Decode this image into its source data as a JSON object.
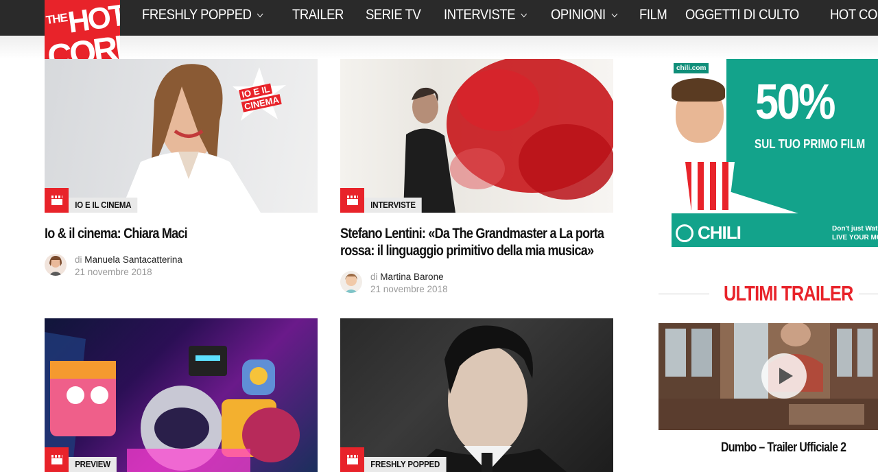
{
  "logo": {
    "line1": "THE",
    "line2": "HOT",
    "line3": "CORN"
  },
  "nav": {
    "items": [
      {
        "label": "FRESHLY POPPED",
        "dropdown": true
      },
      {
        "label": "TRAILER",
        "dropdown": false
      },
      {
        "label": "SERIE TV",
        "dropdown": false
      },
      {
        "label": "INTERVISTE",
        "dropdown": true
      },
      {
        "label": "OPINIONI",
        "dropdown": true
      },
      {
        "label": "FILM",
        "dropdown": false
      },
      {
        "label": "OGGETTI DI CULTO",
        "dropdown": false
      },
      {
        "label": "HOT CORN TV",
        "dropdown": true
      }
    ]
  },
  "articles": [
    {
      "category": "IO E IL CINEMA",
      "title": "Io & il cinema: Chiara Maci",
      "by_prefix": "di",
      "author": "Manuela Santacatterina",
      "date": "21 novembre 2018",
      "badge_text_1": "IO E IL",
      "badge_text_2": "CINEMA"
    },
    {
      "category": "INTERVISTE",
      "title_line1": "Stefano Lentini: «Da The Grandmaster a La porta",
      "title_line2": "rossa: il linguaggio primitivo della mia musica»",
      "by_prefix": "di",
      "author": "Martina Barone",
      "date": "21 novembre 2018"
    },
    {
      "category": "PREVIEW"
    },
    {
      "category": "FRESHLY POPPED"
    }
  ],
  "ad": {
    "badge": "chili.com",
    "headline": "50%",
    "subline": "SUL TUO PRIMO FILM",
    "brand": "CHILI",
    "tagline1": "Don't just Wat",
    "tagline2": "LIVE YOUR MO"
  },
  "sidebar": {
    "section_title": "ULTIMI TRAILER",
    "trailer_title": "Dumbo – Trailer Ufficiale 2"
  },
  "colors": {
    "accent": "#e8232a",
    "nav_bg": "#2a2a2a",
    "ad_green": "#13a38b"
  }
}
